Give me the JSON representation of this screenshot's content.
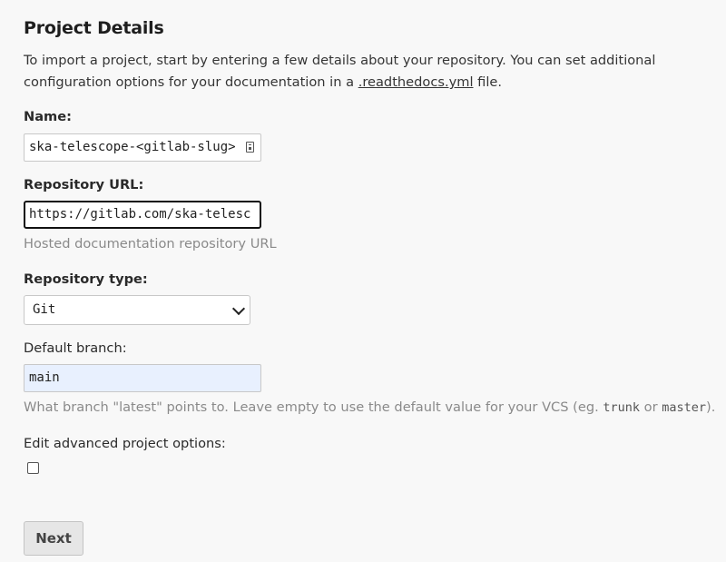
{
  "header": {
    "title": "Project Details"
  },
  "intro": {
    "text_before_link": "To import a project, start by entering a few details about your repository. You can set additional configuration options for your documentation in a ",
    "link": ".readthedocs.yml",
    "text_after_link": " file."
  },
  "form": {
    "name": {
      "label": "Name:",
      "value": "ska-telescope-<gitlab-slug>"
    },
    "repo_url": {
      "label": "Repository URL:",
      "value": "https://gitlab.com/ska-telesc",
      "help": "Hosted documentation repository URL"
    },
    "repo_type": {
      "label": "Repository type:",
      "selected": "Git"
    },
    "default_branch": {
      "label": "Default branch:",
      "value": "main",
      "help_before": "What branch \"latest\" points to. Leave empty to use the default value for your VCS (eg. ",
      "help_code1": "trunk",
      "help_mid": " or ",
      "help_code2": "master",
      "help_after": ")."
    },
    "advanced": {
      "label": "Edit advanced project options:",
      "checked": false
    }
  },
  "actions": {
    "next_label": "Next"
  }
}
